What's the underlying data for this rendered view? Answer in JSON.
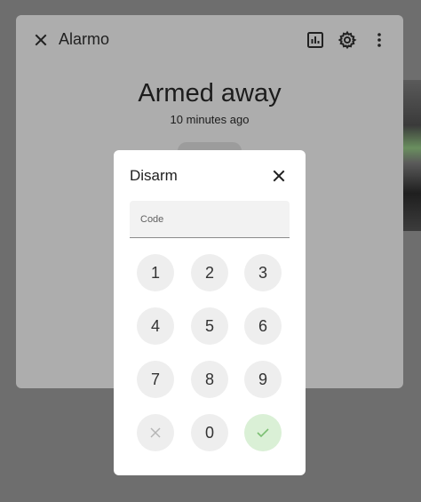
{
  "app": {
    "title": "Alarmo",
    "state": "Armed away",
    "last_changed": "10 minutes ago",
    "icons": [
      "close-icon",
      "chart-icon",
      "gear-icon",
      "more-vert-icon"
    ]
  },
  "dialog": {
    "title": "Disarm",
    "code_placeholder": "Code",
    "keys": [
      "1",
      "2",
      "3",
      "4",
      "5",
      "6",
      "7",
      "8",
      "9",
      "0"
    ],
    "clear_icon": "clear-icon",
    "submit_icon": "check-icon",
    "colors": {
      "submit_bg": "#daf0d6",
      "key_bg": "#eeeeee"
    }
  }
}
